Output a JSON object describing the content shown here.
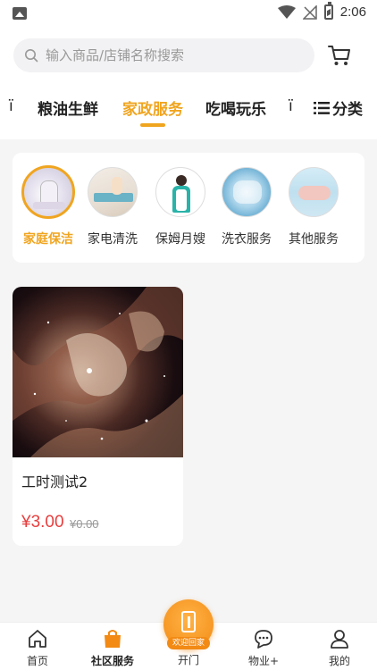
{
  "status_bar": {
    "time": "2:06",
    "icons": [
      "gallery-icon",
      "wifi-icon",
      "no-signal-icon",
      "battery-charging-icon"
    ]
  },
  "search": {
    "placeholder": "输入商品/店铺名称搜索",
    "icon": "search-icon"
  },
  "cart": {
    "icon": "cart-icon"
  },
  "tabs": {
    "left_partial": "ï",
    "items": [
      {
        "label": "粮油生鲜",
        "active": false
      },
      {
        "label": "家政服务",
        "active": true
      },
      {
        "label": "吃喝玩乐",
        "active": false
      }
    ],
    "right_partial": "ï",
    "category_label": "分类",
    "category_icon": "list-icon"
  },
  "categories": [
    {
      "label": "家庭保洁",
      "active": true,
      "icon": "cleaning-photo"
    },
    {
      "label": "家电清洗",
      "active": false,
      "icon": "appliance-photo"
    },
    {
      "label": "保姆月嫂",
      "active": false,
      "icon": "nanny-photo"
    },
    {
      "label": "洗衣服务",
      "active": false,
      "icon": "laundry-photo"
    },
    {
      "label": "其他服务",
      "active": false,
      "icon": "other-service-photo"
    }
  ],
  "products": [
    {
      "name": "工时测试2",
      "price": "¥3.00",
      "original_price": "¥0.00",
      "image": "nebula-image"
    }
  ],
  "bottom_nav": {
    "items": [
      {
        "label": "首页",
        "icon": "home-icon",
        "active": false
      },
      {
        "label": "社区服务",
        "icon": "shopping-bag-icon",
        "active": true
      },
      {
        "label": "物业+",
        "icon": "chat-icon",
        "active": false
      },
      {
        "label": "我的",
        "icon": "user-icon",
        "active": false
      }
    ],
    "center": {
      "label": "开门",
      "badge": "欢迎回家",
      "icon": "door-icon"
    }
  },
  "colors": {
    "accent": "#f0a520",
    "price": "#e83e3e",
    "background": "#f5f5f5"
  }
}
